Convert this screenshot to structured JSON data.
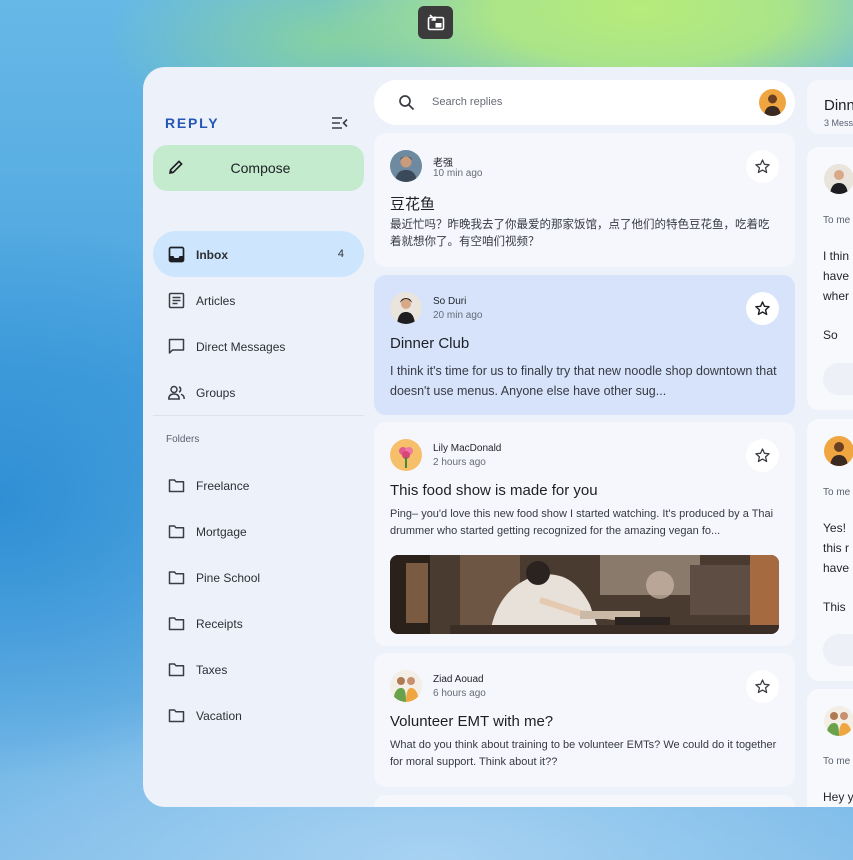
{
  "app": {
    "brand": "REPLY",
    "compose_label": "Compose"
  },
  "nav": [
    {
      "label": "Inbox",
      "badge": "4",
      "icon": "inbox-icon",
      "active": true
    },
    {
      "label": "Articles",
      "icon": "article-icon"
    },
    {
      "label": "Direct Messages",
      "icon": "chat-icon"
    },
    {
      "label": "Groups",
      "icon": "groups-icon"
    }
  ],
  "folders": {
    "title": "Folders",
    "items": [
      "Freelance",
      "Mortgage",
      "Pine School",
      "Receipts",
      "Taxes",
      "Vacation"
    ]
  },
  "search": {
    "placeholder": "Search replies"
  },
  "emails": [
    {
      "sender": "老强",
      "time": "10 min ago",
      "subject": "豆花鱼",
      "preview": "最近忙吗？昨晚我去了你最爱的那家饭馆，点了他们的特色豆花鱼，吃着吃着就想你了。有空咱们视频？",
      "selected": false
    },
    {
      "sender": "So Duri",
      "time": "20 min ago",
      "subject": "Dinner Club",
      "preview": "I think it's time for us to finally try that new noodle shop downtown that doesn't use menus. Anyone else have other sug...",
      "selected": true
    },
    {
      "sender": "Lily MacDonald",
      "time": "2 hours ago",
      "subject": "This food show is made for you",
      "preview": "Ping– you'd love this new food show I started watching. It's produced by a Thai drummer who started getting recognized for the amazing vegan fo...",
      "selected": false
    },
    {
      "sender": "Ziad Aouad",
      "time": "6 hours ago",
      "subject": "Volunteer EMT with me?",
      "preview": "What do you think about training to be volunteer EMTs? We could do it together for moral support. Think about it??",
      "selected": false
    }
  ],
  "detail": {
    "title": "Dinn",
    "count": "3 Mess",
    "messages": [
      {
        "to": "To me",
        "lines": [
          "I thin",
          "have",
          "wher",
          "",
          "So"
        ]
      },
      {
        "to": "To me",
        "lines": [
          "Yes!",
          "this r",
          "have",
          "",
          "This"
        ]
      },
      {
        "to": "To me",
        "lines": [
          "Hey y"
        ]
      }
    ]
  },
  "colors": {
    "brand": "#2457b8",
    "compose_bg": "#c4ebcd",
    "active_nav_bg": "#cde6fd",
    "selected_card_bg": "#d6e3fb",
    "surface": "#edf1fa"
  }
}
